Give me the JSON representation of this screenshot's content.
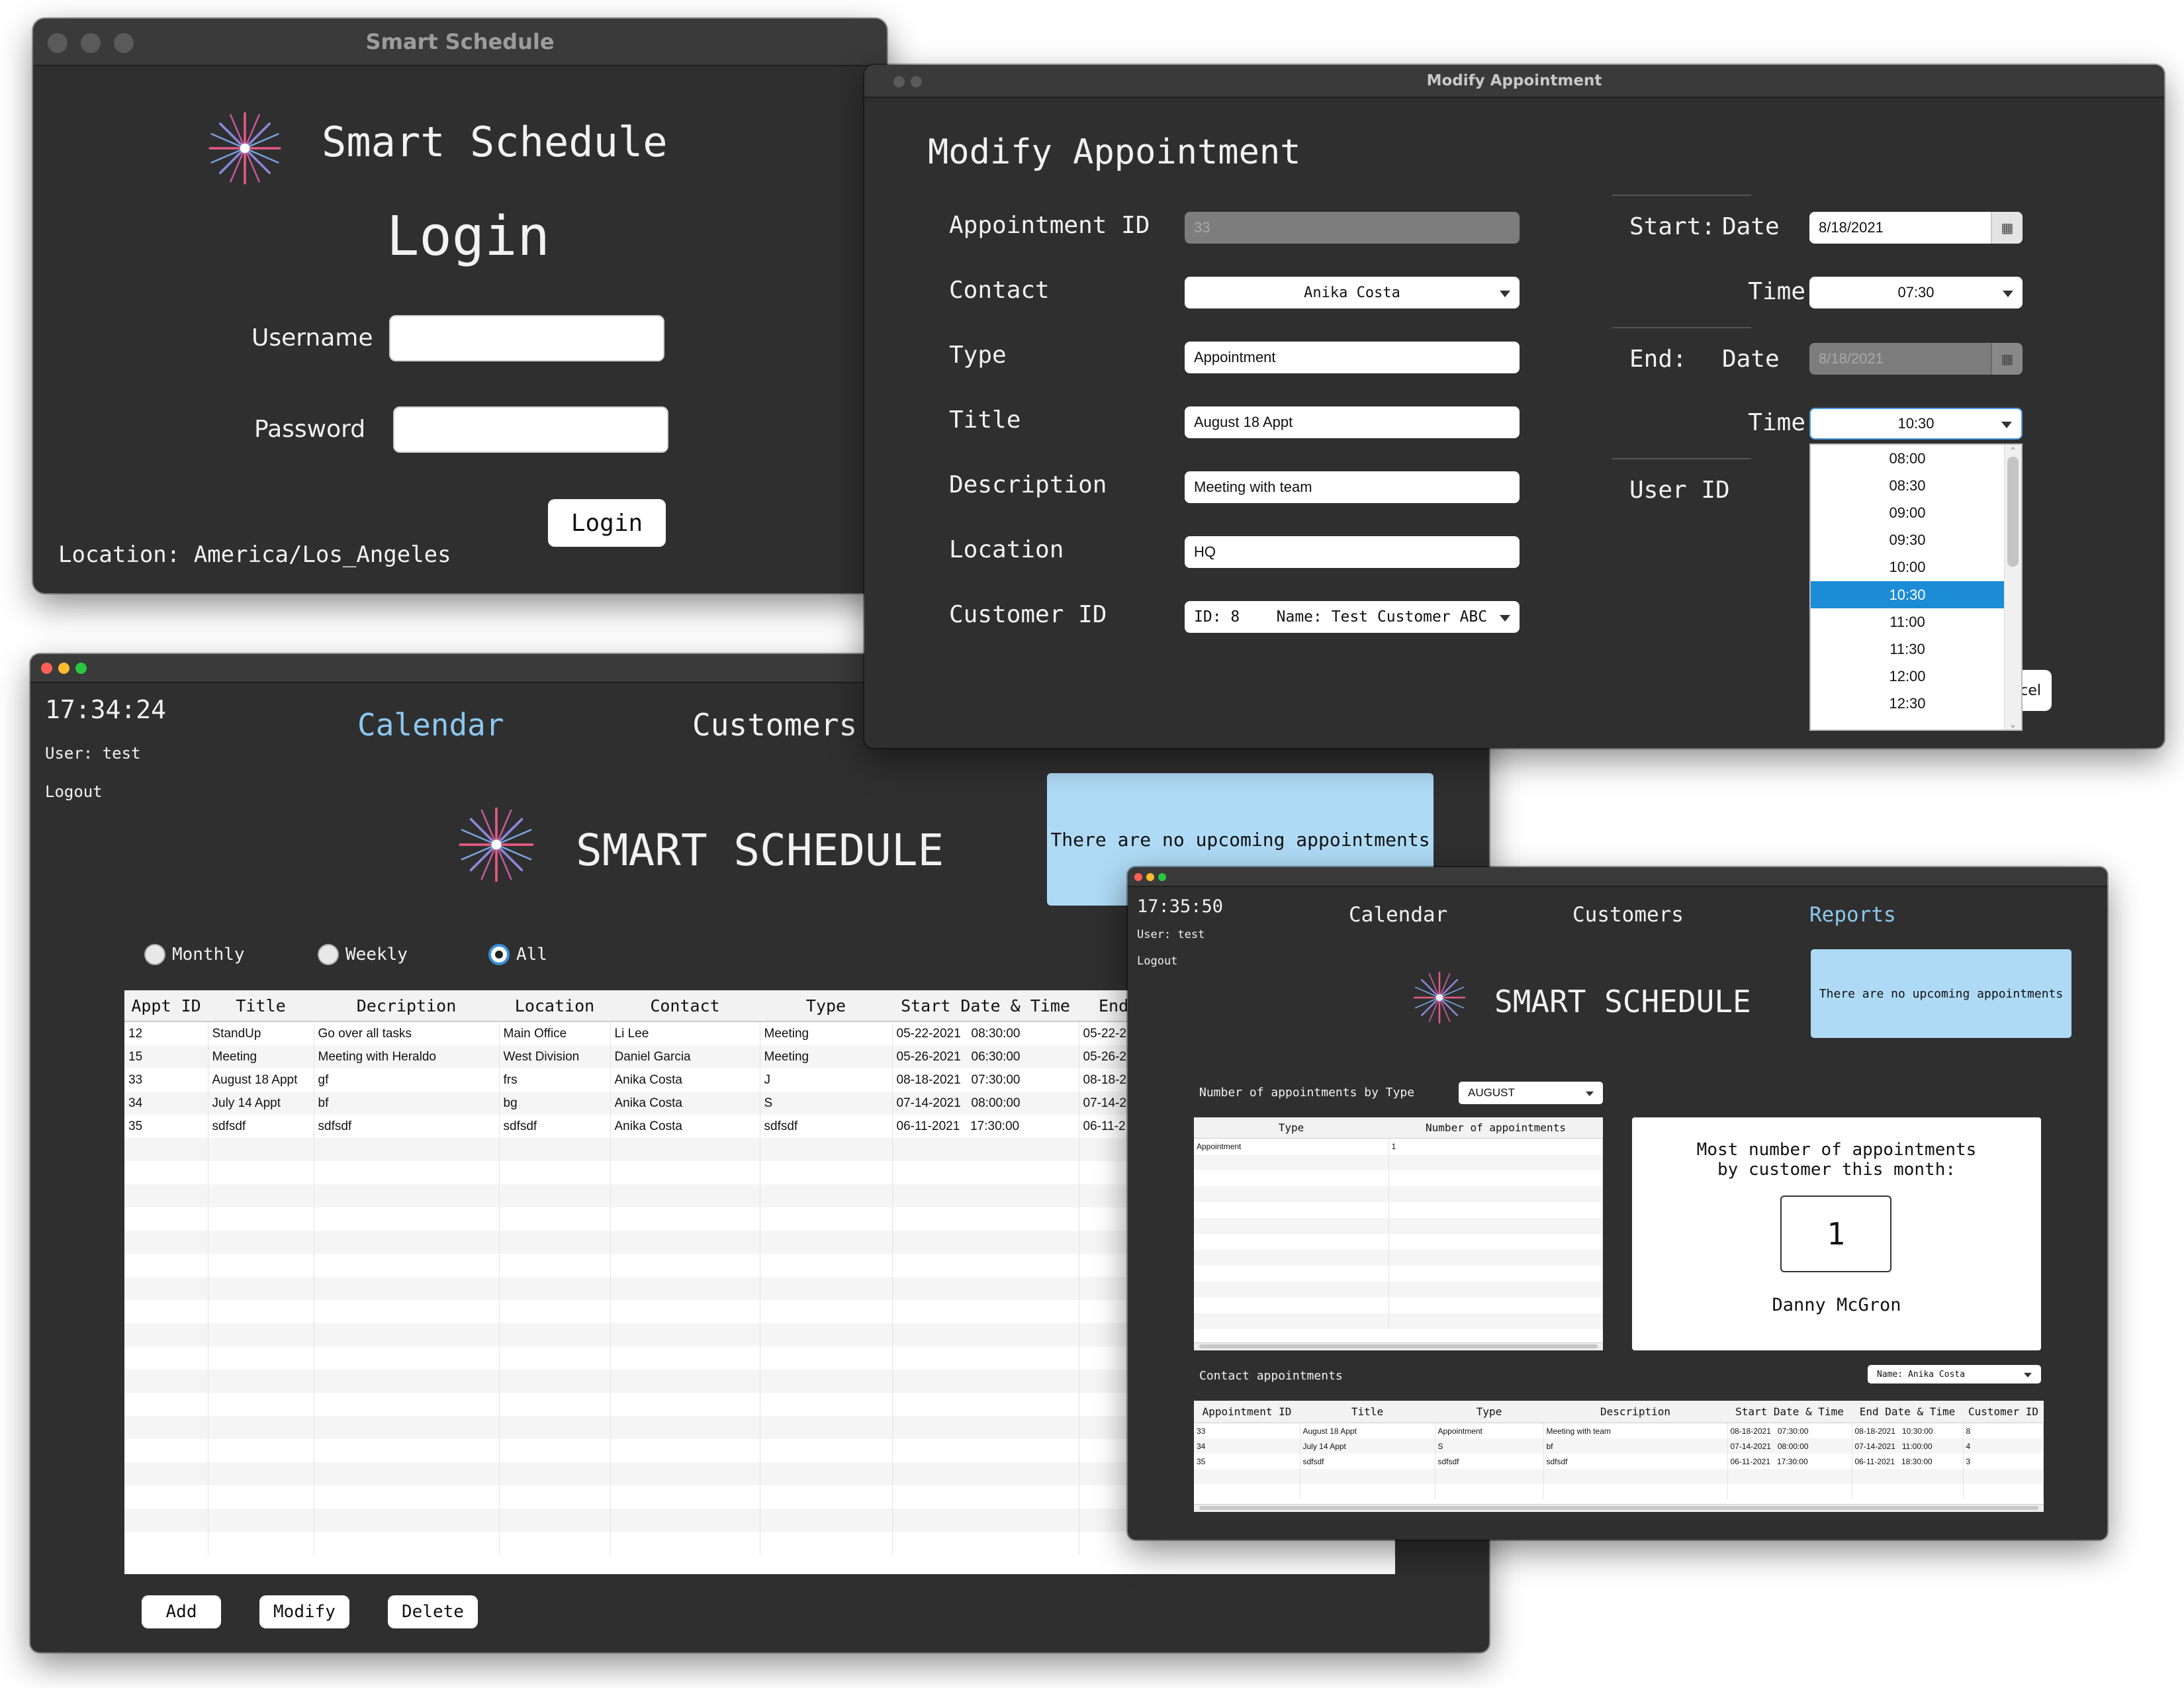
{
  "colors": {
    "window_bg": "#2f2f2f",
    "titlebar_bg": "#3a3a3a",
    "nav_active": "#8cc8f0",
    "notice_bg": "#aedaf5",
    "dropdown_selected": "#1d8cd6"
  },
  "login_window": {
    "window_title": "Smart Schedule",
    "app_title": "Smart Schedule",
    "heading": "Login",
    "username_label": "Username",
    "password_label": "Password",
    "username_value": "",
    "password_value": "",
    "login_button": "Login",
    "location_text": "Location: America/Los_Angeles",
    "logo_icon": "starburst-logo-icon"
  },
  "modify_window": {
    "window_title": "Modify Appointment",
    "heading": "Modify Appointment",
    "fields": {
      "appointment_id_label": "Appointment ID",
      "appointment_id_value": "33",
      "contact_label": "Contact",
      "contact_value": "Anika Costa",
      "type_label": "Type",
      "type_value": "Appointment",
      "title_label": "Title",
      "title_value": "August 18 Appt",
      "description_label": "Description",
      "description_value": "Meeting with team",
      "location_label": "Location",
      "location_value": "HQ",
      "customer_id_label": "Customer ID",
      "customer_id_value": "ID: 8    Name: Test Customer ABC"
    },
    "schedule": {
      "start_label": "Start:",
      "end_label": "End:",
      "date_label": "Date",
      "time_label": "Time",
      "start_date": "8/18/2021",
      "start_time": "07:30",
      "end_date": "8/18/2021",
      "end_time": "10:30",
      "user_id_label": "User ID"
    },
    "time_options": [
      "08:00",
      "08:30",
      "09:00",
      "09:30",
      "10:00",
      "10:30",
      "11:00",
      "11:30",
      "12:00",
      "12:30"
    ],
    "selected_time_index": 5,
    "cancel_button_partial": "cel"
  },
  "calendar_window": {
    "clock": "17:34:24",
    "user": "User: test",
    "logout": "Logout",
    "nav_calendar": "Calendar",
    "nav_customers": "Customers",
    "app_title": "SMART SCHEDULE",
    "notice": "There are no upcoming appointments",
    "filters": [
      {
        "label": "Monthly",
        "selected": false
      },
      {
        "label": "Weekly",
        "selected": false
      },
      {
        "label": "All",
        "selected": true
      }
    ],
    "columns": [
      "Appt ID",
      "Title",
      "Decription",
      "Location",
      "Contact",
      "Type",
      "Start Date & Time",
      "End"
    ],
    "rows": [
      [
        "12",
        "StandUp",
        "Go over all tasks",
        "Main Office",
        "Li Lee",
        "Meeting",
        "05-22-2021   08:30:00",
        "05-22-2"
      ],
      [
        "15",
        "Meeting",
        "Meeting with Heraldo",
        "West Division",
        "Daniel Garcia",
        "Meeting",
        "05-26-2021   06:30:00",
        "05-26-2"
      ],
      [
        "33",
        "August 18 Appt",
        "gf",
        "frs",
        "Anika Costa",
        "J",
        "08-18-2021   07:30:00",
        "08-18-2"
      ],
      [
        "34",
        "July 14 Appt",
        "bf",
        "bg",
        "Anika Costa",
        "S",
        "07-14-2021   08:00:00",
        "07-14-2"
      ],
      [
        "35",
        "sdfsdf",
        "sdfsdf",
        "sdfsdf",
        "Anika Costa",
        "sdfsdf",
        "06-11-2021   17:30:00",
        "06-11-2"
      ]
    ],
    "add_button": "Add",
    "modify_button": "Modify",
    "delete_button": "Delete"
  },
  "reports_window": {
    "clock": "17:35:50",
    "user": "User: test",
    "logout": "Logout",
    "nav_calendar": "Calendar",
    "nav_customers": "Customers",
    "nav_reports": "Reports",
    "app_title": "SMART SCHEDULE",
    "notice": "There are no upcoming appointments",
    "by_type_label": "Number of appointments by Type",
    "month_select": "AUGUST",
    "type_columns": [
      "Type",
      "Number of appointments"
    ],
    "type_rows": [
      [
        "Appointment",
        "1"
      ]
    ],
    "most_label_line1": "Most number of appointments",
    "most_label_line2": "by customer this month:",
    "most_count": "1",
    "most_customer": "Danny McGron",
    "contact_label": "Contact appointments",
    "contact_select": "Name: Anika Costa",
    "contact_columns": [
      "Appointment ID",
      "Title",
      "Type",
      "Description",
      "Start Date & Time",
      "End Date & Time",
      "Customer ID"
    ],
    "contact_rows": [
      [
        "33",
        "August 18 Appt",
        "Appointment",
        "Meeting with team",
        "08-18-2021   07:30:00",
        "08-18-2021   10:30:00",
        "8"
      ],
      [
        "34",
        "July 14 Appt",
        "S",
        "bf",
        "07-14-2021   08:00:00",
        "07-14-2021   11:00:00",
        "4"
      ],
      [
        "35",
        "sdfsdf",
        "sdfsdf",
        "sdfsdf",
        "06-11-2021   17:30:00",
        "06-11-2021   18:30:00",
        "3"
      ]
    ]
  }
}
